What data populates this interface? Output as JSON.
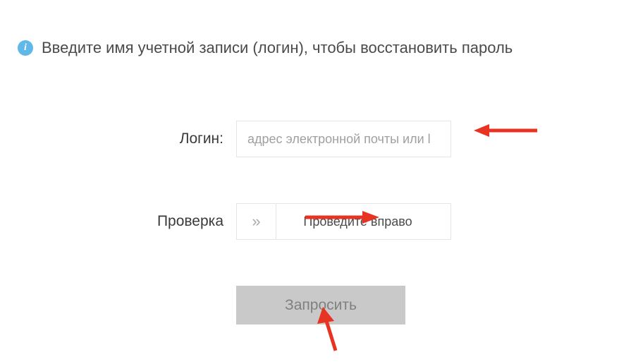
{
  "info": {
    "icon_glyph": "i",
    "text": "Введите имя учетной записи (логин), чтобы восстановить пароль"
  },
  "form": {
    "login": {
      "label": "Логин:",
      "placeholder": "адрес электронной почты или l"
    },
    "verify": {
      "label": "Проверка",
      "slider_hint": "Проведите вправо",
      "handle_glyph": "»"
    },
    "submit": {
      "label": "Запросить"
    }
  },
  "annotations": {
    "arrow_color": "#e83323"
  }
}
